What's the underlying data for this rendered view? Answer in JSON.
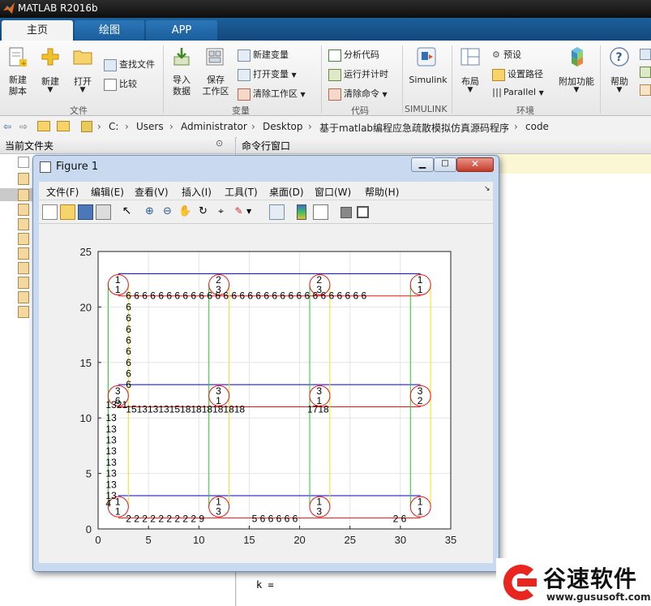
{
  "app": {
    "title": "MATLAB R2016b"
  },
  "tabs": [
    {
      "label": "主页"
    },
    {
      "label": "绘图"
    },
    {
      "label": "APP"
    }
  ],
  "ribbon": {
    "file": {
      "new_script": [
        "新建",
        "脚本"
      ],
      "new": "新建",
      "open": "打开",
      "find_files": "查找文件",
      "compare": "比较",
      "group": "文件"
    },
    "variable": {
      "import": [
        "导入",
        "数据"
      ],
      "save": [
        "保存",
        "工作区"
      ],
      "new_var": "新建变量",
      "open_var": "打开变量",
      "clear_ws": "清除工作区",
      "group": "变量"
    },
    "code": {
      "analyze": "分析代码",
      "run_time": "运行并计时",
      "clear_cmd": "清除命令",
      "group": "代码"
    },
    "simulink": {
      "label": "Simulink",
      "group": "SIMULINK"
    },
    "env": {
      "layout": "布局",
      "prefs": "预设",
      "set_path": "设置路径",
      "parallel": "Parallel",
      "addons": "附加功能",
      "group": "环境"
    },
    "resources": {
      "help": "帮助"
    }
  },
  "address": {
    "path": [
      "C:",
      "Users",
      "Administrator",
      "Desktop",
      "基于matlab编程应急疏散模拟仿真源码程序",
      "code"
    ]
  },
  "panels": {
    "current_folder": "当前文件夹",
    "command_window": "命令行窗口",
    "cmd_output": "k ="
  },
  "figure": {
    "title": "Figure 1",
    "menu": [
      "文件(F)",
      "编辑(E)",
      "查看(V)",
      "插入(I)",
      "工具(T)",
      "桌面(D)",
      "窗口(W)",
      "帮助(H)"
    ]
  },
  "chart_data": {
    "type": "scatter",
    "title": "",
    "xlabel": "",
    "ylabel": "",
    "xlim": [
      0,
      35
    ],
    "ylim": [
      0,
      25
    ],
    "xticks": [
      0,
      5,
      10,
      15,
      20,
      25,
      30,
      35
    ],
    "yticks": [
      0,
      5,
      10,
      15,
      20,
      25
    ],
    "grid": true,
    "circles": [
      {
        "x": 2,
        "y": 22,
        "labels": [
          "1",
          "1"
        ]
      },
      {
        "x": 12,
        "y": 22,
        "labels": [
          "2",
          "3"
        ]
      },
      {
        "x": 22,
        "y": 22,
        "labels": [
          "2",
          "3"
        ]
      },
      {
        "x": 32,
        "y": 22,
        "labels": [
          "1",
          "1"
        ]
      },
      {
        "x": 2,
        "y": 12,
        "labels": [
          "3",
          "6"
        ]
      },
      {
        "x": 12,
        "y": 12,
        "labels": [
          "3",
          "1"
        ]
      },
      {
        "x": 22,
        "y": 12,
        "labels": [
          "3",
          "1"
        ]
      },
      {
        "x": 32,
        "y": 12,
        "labels": [
          "3",
          "2"
        ]
      },
      {
        "x": 2,
        "y": 2,
        "labels": [
          "1",
          "1"
        ]
      },
      {
        "x": 12,
        "y": 2,
        "labels": [
          "1",
          "3"
        ]
      },
      {
        "x": 22,
        "y": 2,
        "labels": [
          "1",
          "3"
        ]
      },
      {
        "x": 32,
        "y": 2,
        "labels": [
          "1",
          "1"
        ]
      }
    ],
    "lines": [
      {
        "color": "blue",
        "x": [
          2,
          32
        ],
        "y": [
          23,
          23
        ]
      },
      {
        "color": "blue",
        "x": [
          2,
          32
        ],
        "y": [
          13,
          13
        ]
      },
      {
        "color": "blue",
        "x": [
          2,
          32
        ],
        "y": [
          3,
          3
        ]
      },
      {
        "color": "red",
        "x": [
          2,
          32
        ],
        "y": [
          21,
          21
        ]
      },
      {
        "color": "red",
        "x": [
          2,
          32
        ],
        "y": [
          11,
          11
        ]
      },
      {
        "color": "red",
        "x": [
          2,
          32
        ],
        "y": [
          1,
          1
        ]
      },
      {
        "color": "green",
        "x": [
          1,
          1
        ],
        "y": [
          2,
          22
        ]
      },
      {
        "color": "green",
        "x": [
          11,
          11
        ],
        "y": [
          2,
          22
        ]
      },
      {
        "color": "green",
        "x": [
          21,
          21
        ],
        "y": [
          2,
          22
        ]
      },
      {
        "color": "green",
        "x": [
          31,
          31
        ],
        "y": [
          2,
          22
        ]
      },
      {
        "color": "yellow",
        "x": [
          3,
          3
        ],
        "y": [
          2,
          22
        ]
      },
      {
        "color": "yellow",
        "x": [
          13,
          13
        ],
        "y": [
          2,
          22
        ]
      },
      {
        "color": "yellow",
        "x": [
          23,
          23
        ],
        "y": [
          2,
          22
        ]
      },
      {
        "color": "yellow",
        "x": [
          33,
          33
        ],
        "y": [
          2,
          22
        ]
      }
    ],
    "annotations": [
      {
        "x": 3,
        "y": 21,
        "text": "6 6 6 6 6 6 6 6 6 6 6 6 6 6 6 6 6 6 6 6 6 6 6 6 6 6 6 6 6 6"
      },
      {
        "x": 3,
        "y": 20,
        "text": "6"
      },
      {
        "x": 3,
        "y": 19,
        "text": "6"
      },
      {
        "x": 3,
        "y": 18,
        "text": "6"
      },
      {
        "x": 3,
        "y": 17,
        "text": "6"
      },
      {
        "x": 3,
        "y": 16,
        "text": "6"
      },
      {
        "x": 3,
        "y": 15,
        "text": "6"
      },
      {
        "x": 3,
        "y": 14,
        "text": "6"
      },
      {
        "x": 3,
        "y": 13,
        "text": "6"
      },
      {
        "x": 1,
        "y": 11.2,
        "text": "1321"
      },
      {
        "x": 3,
        "y": 10.8,
        "text": "1513131315181818181818"
      },
      {
        "x": 21,
        "y": 10.8,
        "text": "1718"
      },
      {
        "x": 1,
        "y": 10,
        "text": "13"
      },
      {
        "x": 1,
        "y": 9,
        "text": "13"
      },
      {
        "x": 1,
        "y": 8,
        "text": "13"
      },
      {
        "x": 1,
        "y": 7,
        "text": "13"
      },
      {
        "x": 1,
        "y": 6,
        "text": "13"
      },
      {
        "x": 1,
        "y": 5,
        "text": "13"
      },
      {
        "x": 1,
        "y": 4,
        "text": "13"
      },
      {
        "x": 1,
        "y": 3,
        "text": "13"
      },
      {
        "x": 1,
        "y": 2.3,
        "text": "4"
      },
      {
        "x": 3,
        "y": 0.9,
        "text": "2 2 2 2 2 2 2 2 2 9"
      },
      {
        "x": 15.5,
        "y": 0.9,
        "text": "5 6 6 6 6 6"
      },
      {
        "x": 29.5,
        "y": 0.9,
        "text": "2 6"
      }
    ]
  },
  "watermark": {
    "brand": "谷速软件",
    "url": "www.gususoft.com"
  }
}
